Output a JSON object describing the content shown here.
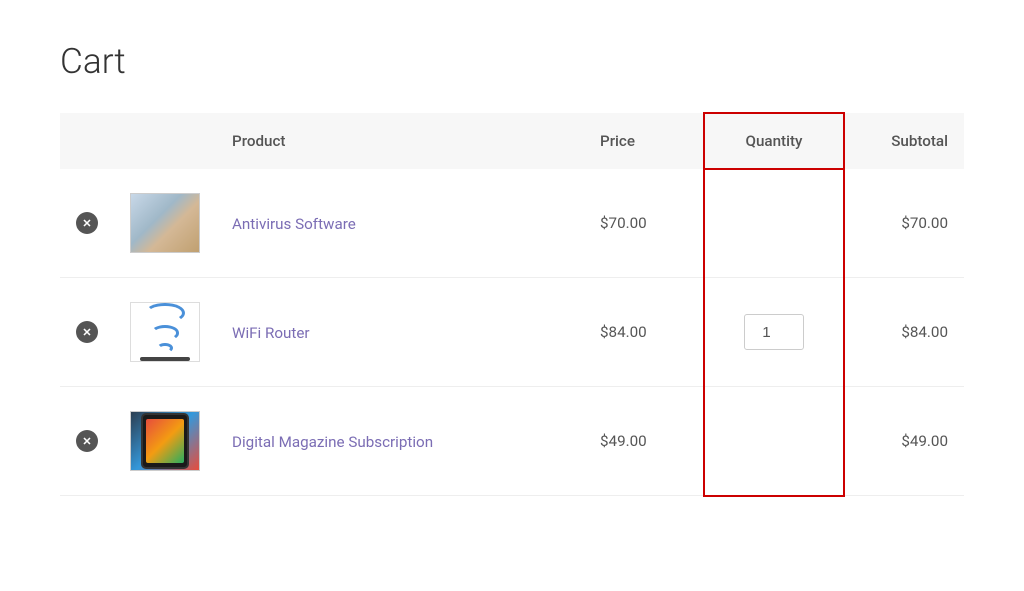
{
  "page": {
    "title": "Cart"
  },
  "table": {
    "headers": {
      "remove": "",
      "image": "",
      "product": "Product",
      "price": "Price",
      "quantity": "Quantity",
      "subtotal": "Subtotal"
    },
    "rows": [
      {
        "id": "antivirus",
        "product_name": "Antivirus Software",
        "price": "$70.00",
        "quantity": "",
        "subtotal": "$70.00"
      },
      {
        "id": "wifi-router",
        "product_name": "WiFi Router",
        "price": "$84.00",
        "quantity": "1",
        "subtotal": "$84.00"
      },
      {
        "id": "digital-magazine",
        "product_name": "Digital Magazine Subscription",
        "price": "$49.00",
        "quantity": "",
        "subtotal": "$49.00"
      }
    ]
  }
}
